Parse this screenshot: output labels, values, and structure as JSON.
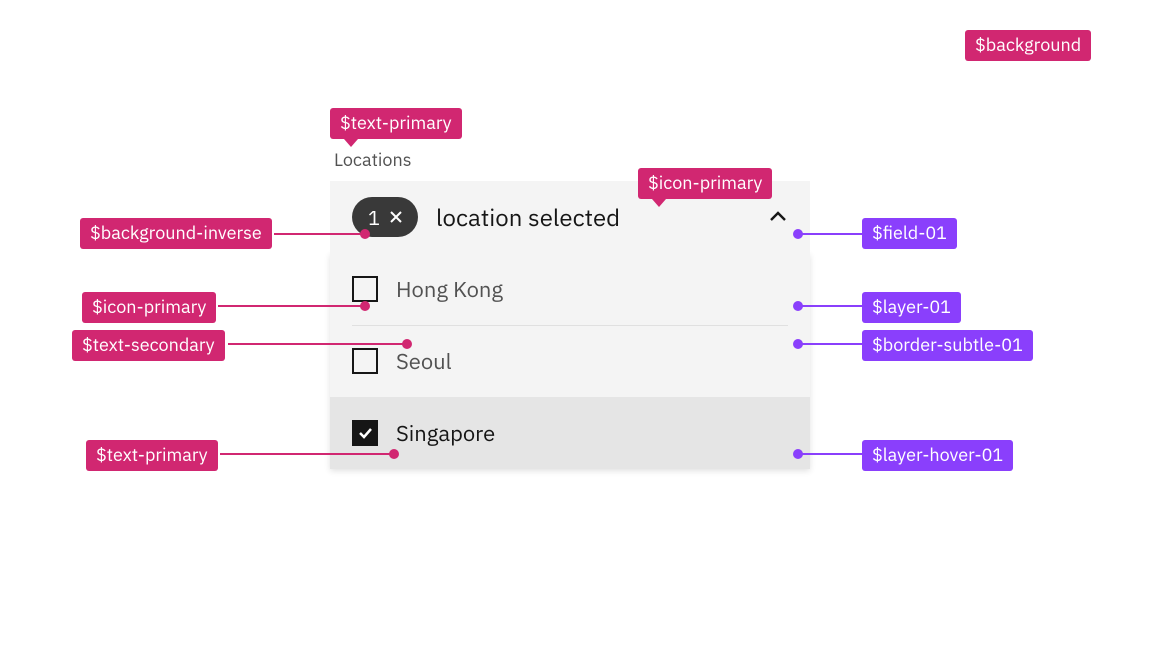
{
  "multiselect": {
    "label": "Locations",
    "tag_count": "1",
    "summary": "location selected",
    "options": [
      {
        "label": "Hong Kong",
        "checked": false,
        "hover": false
      },
      {
        "label": "Seoul",
        "checked": false,
        "hover": false
      },
      {
        "label": "Singapore",
        "checked": true,
        "hover": true
      }
    ]
  },
  "tokens": {
    "background": "$background",
    "text_primary_1": "$text-primary",
    "icon_primary_1": "$icon-primary",
    "background_inverse": "$background-inverse",
    "field_01": "$field-01",
    "icon_primary_2": "$icon-primary",
    "layer_01": "$layer-01",
    "text_secondary": "$text-secondary",
    "border_subtle_01": "$border-subtle-01",
    "text_primary_2": "$text-primary",
    "layer_hover_01": "$layer-hover-01"
  },
  "colors": {
    "pink": "#d12771",
    "purple": "#8a3ffc"
  }
}
